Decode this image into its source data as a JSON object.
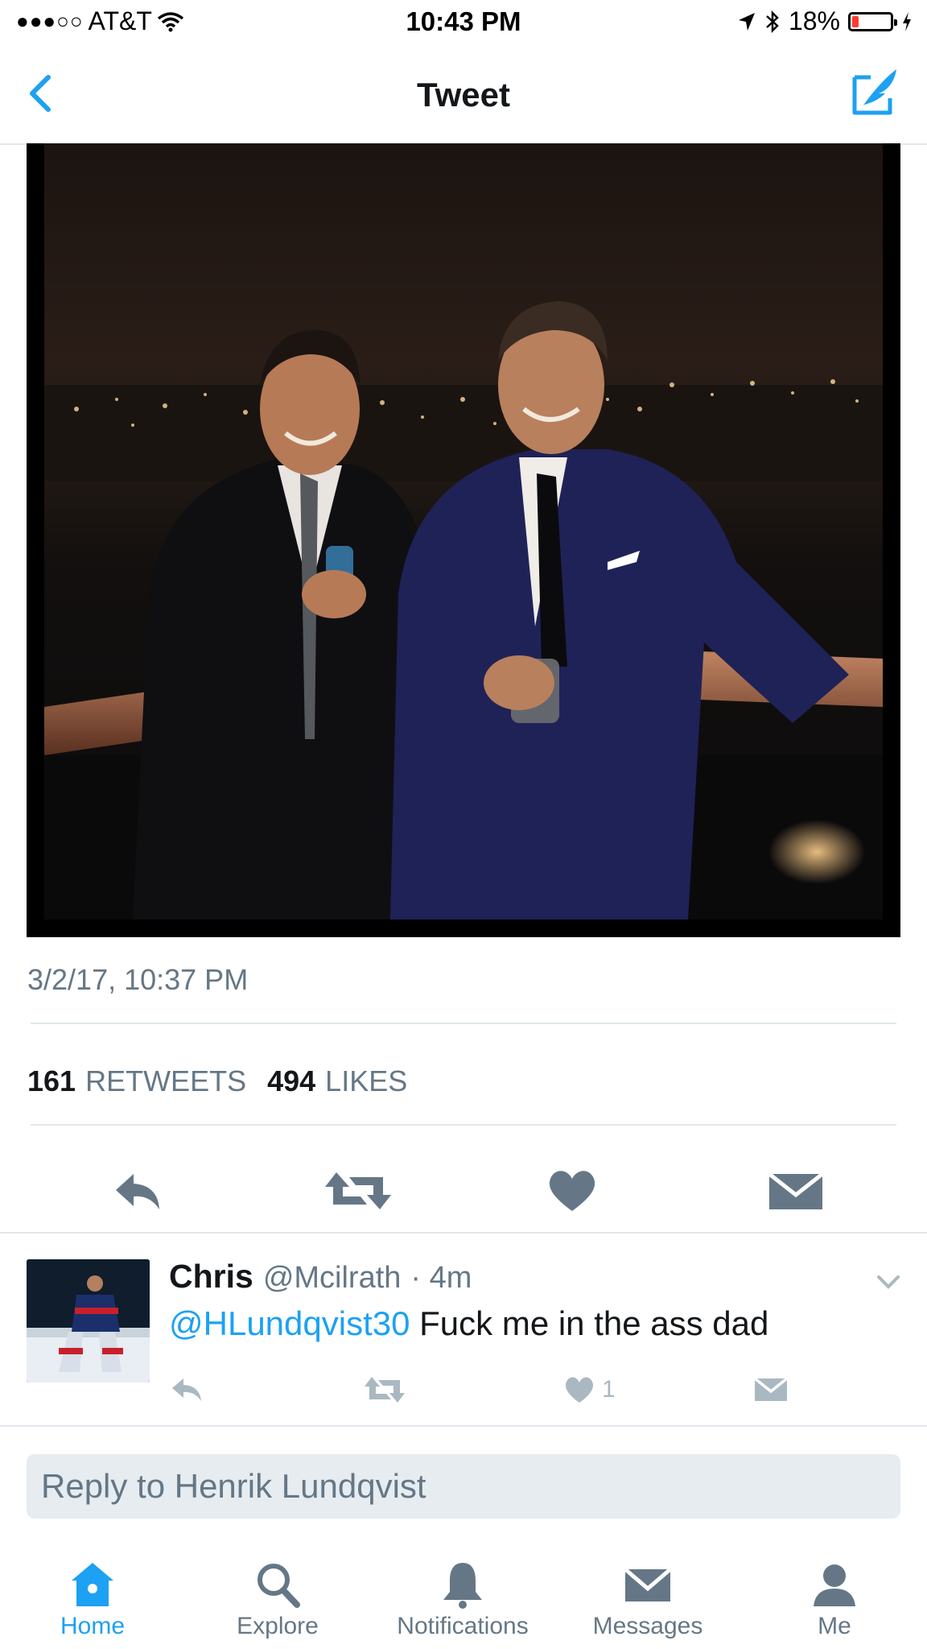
{
  "status_bar": {
    "signal": "●●●○○",
    "carrier": "AT&T",
    "time": "10:43 PM",
    "battery_text": "18%",
    "battery_level": 0.18
  },
  "nav": {
    "title": "Tweet"
  },
  "tweet": {
    "timestamp": "3/2/17, 10:37 PM",
    "retweets_count": "161",
    "retweets_label": "RETWEETS",
    "likes_count": "494",
    "likes_label": "LIKES"
  },
  "reply_tweet": {
    "name": "Chris",
    "handle": "@Mcilrath",
    "time": "· 4m",
    "mention": "@HLundqvist30",
    "text": " Fuck me in the ass dad",
    "like_count": "1"
  },
  "reply_bar": {
    "placeholder": "Reply to Henrik Lundqvist"
  },
  "tabs": [
    {
      "label": "Home",
      "icon": "home-icon",
      "active": true
    },
    {
      "label": "Explore",
      "icon": "search-icon",
      "active": false
    },
    {
      "label": "Notifications",
      "icon": "bell-icon",
      "active": false
    },
    {
      "label": "Messages",
      "icon": "envelope-icon",
      "active": false
    },
    {
      "label": "Me",
      "icon": "person-icon",
      "active": false
    }
  ],
  "colors": {
    "accent": "#1da1f2",
    "secondary_text": "#657786",
    "icon_gray": "#657786",
    "battery_red": "#ff3b30"
  }
}
